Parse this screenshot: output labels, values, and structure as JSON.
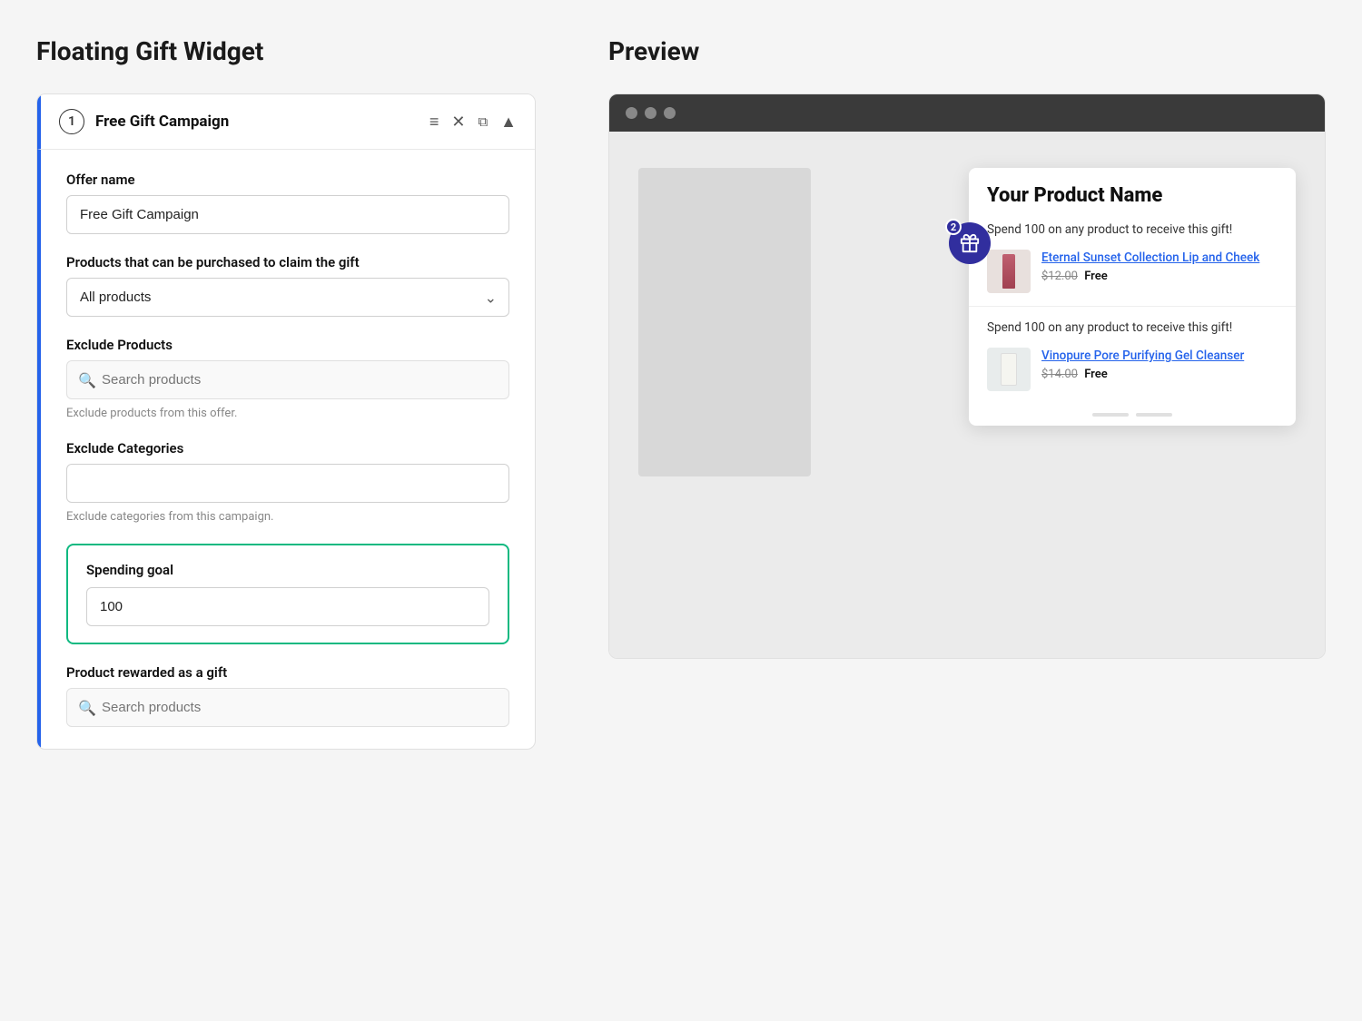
{
  "page": {
    "left_title": "Floating Gift Widget",
    "right_title": "Preview"
  },
  "campaign": {
    "number": "1",
    "name": "Free Gift Campaign",
    "offer_name_label": "Offer name",
    "offer_name_value": "Free Gift Campaign",
    "products_label": "Products that can be purchased to claim the gift",
    "products_value": "All products",
    "exclude_products_label": "Exclude Products",
    "exclude_products_placeholder": "Search products",
    "exclude_products_hint": "Exclude products from this offer.",
    "exclude_categories_label": "Exclude Categories",
    "exclude_categories_placeholder": "",
    "exclude_categories_hint": "Exclude categories from this campaign.",
    "spending_goal_label": "Spending goal",
    "spending_goal_value": "100",
    "product_rewarded_label": "Product rewarded as a gift",
    "product_rewarded_placeholder": "Search products"
  },
  "preview": {
    "product_name": "Your Product Name",
    "badge_count": "2",
    "offer1_description": "Spend 100 on any product to receive this gift!",
    "offer1_product_name": "Eternal Sunset Collection Lip and Cheek",
    "offer1_price_original": "$12.00",
    "offer1_price_free": "Free",
    "offer2_description": "Spend 100 on any product to receive this gift!",
    "offer2_product_name": "Vinopure Pore Purifying Gel Cleanser",
    "offer2_price_original": "$14.00",
    "offer2_price_free": "Free"
  },
  "icons": {
    "hamburger": "≡",
    "close": "×",
    "copy": "⧉",
    "collapse": "▲",
    "chevron_down": "⌄",
    "search": "🔍"
  }
}
